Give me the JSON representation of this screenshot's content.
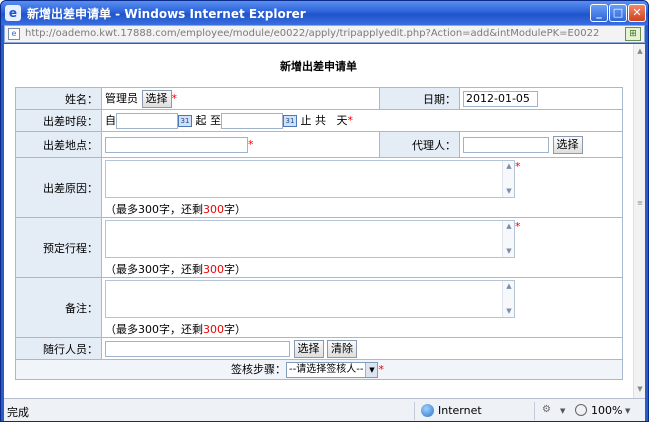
{
  "window": {
    "title": "新增出差申请单 - Windows Internet Explorer",
    "url": "http://oademo.kwt.17888.com/employee/module/e0022/apply/tripapplyedit.php?Action=add&intModulePK=E0022"
  },
  "form": {
    "title": "新增出差申请单",
    "name": {
      "label": "姓名：",
      "value": "管理员",
      "select_button": "选择"
    },
    "date": {
      "label": "日期：",
      "value": "2012-01-05"
    },
    "period": {
      "label": "出差时段：",
      "from": "自",
      "to": "起 至",
      "end": "止 共",
      "unit": "天"
    },
    "location": {
      "label": "出差地点：",
      "value": ""
    },
    "agent": {
      "label": "代理人：",
      "value": "",
      "select_button": "选择"
    },
    "reason": {
      "label": "出差原因：",
      "hint_prefix": "（最多300字，还剩",
      "hint_count": "300",
      "hint_suffix": "字）"
    },
    "itinerary": {
      "label": "预定行程：",
      "hint_prefix": "（最多300字，还剩",
      "hint_count": "300",
      "hint_suffix": "字）"
    },
    "remark": {
      "label": "备注：",
      "hint_prefix": "（最多300字，还剩",
      "hint_count": "300",
      "hint_suffix": "字）"
    },
    "companions": {
      "label": "随行人员：",
      "value": "",
      "select_button": "选择",
      "clear_button": "清除"
    },
    "approval": {
      "label": "签核步骤：",
      "selected": "--请选择签核人--"
    },
    "required_mark": "*"
  },
  "status": {
    "text": "完成",
    "zone": "Internet",
    "zoom": "100%"
  },
  "colors": {
    "titlebar": "#2d63d8",
    "label_bg": "#e4ecf6",
    "required": "#e00000",
    "border": "#a9b8cf"
  }
}
